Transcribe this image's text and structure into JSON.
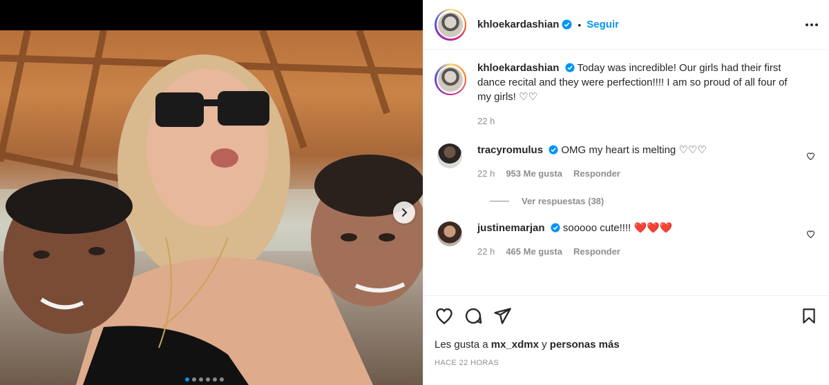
{
  "post": {
    "username": "khloekardashian",
    "separator": "•",
    "follow_label": "Seguir",
    "caption": "Today was incredible! Our girls had their first dance recital and they were perfection!!!! I am so proud of all four of my girls! ♡♡",
    "caption_time": "22 h",
    "carousel": {
      "slides": 6,
      "active_index": 0
    }
  },
  "comments": [
    {
      "username": "tracyromulus",
      "text": "OMG my heart is melting ♡♡♡",
      "time": "22 h",
      "likes": "953 Me gusta",
      "reply_label": "Responder"
    },
    {
      "username": "justinemarjan",
      "text": "sooooo cute!!!! ❤️❤️❤️",
      "time": "22 h",
      "likes": "465 Me gusta",
      "reply_label": "Responder"
    }
  ],
  "view_replies": "Ver respuestas (38)",
  "footer": {
    "likes_prefix": "Les gusta a ",
    "likes_user": "mx_xdmx",
    "likes_mid": " y ",
    "likes_rest": "personas más",
    "timestamp": "HACE 22 HORAS"
  },
  "colors": {
    "accent": "#0095f6",
    "text": "#262626",
    "muted": "#8e8e8e",
    "heart_red": "#e0245e"
  },
  "icons": [
    "verified-icon",
    "more-icon",
    "heart-icon",
    "comment-icon",
    "share-icon",
    "save-icon",
    "chevron-right-icon"
  ]
}
